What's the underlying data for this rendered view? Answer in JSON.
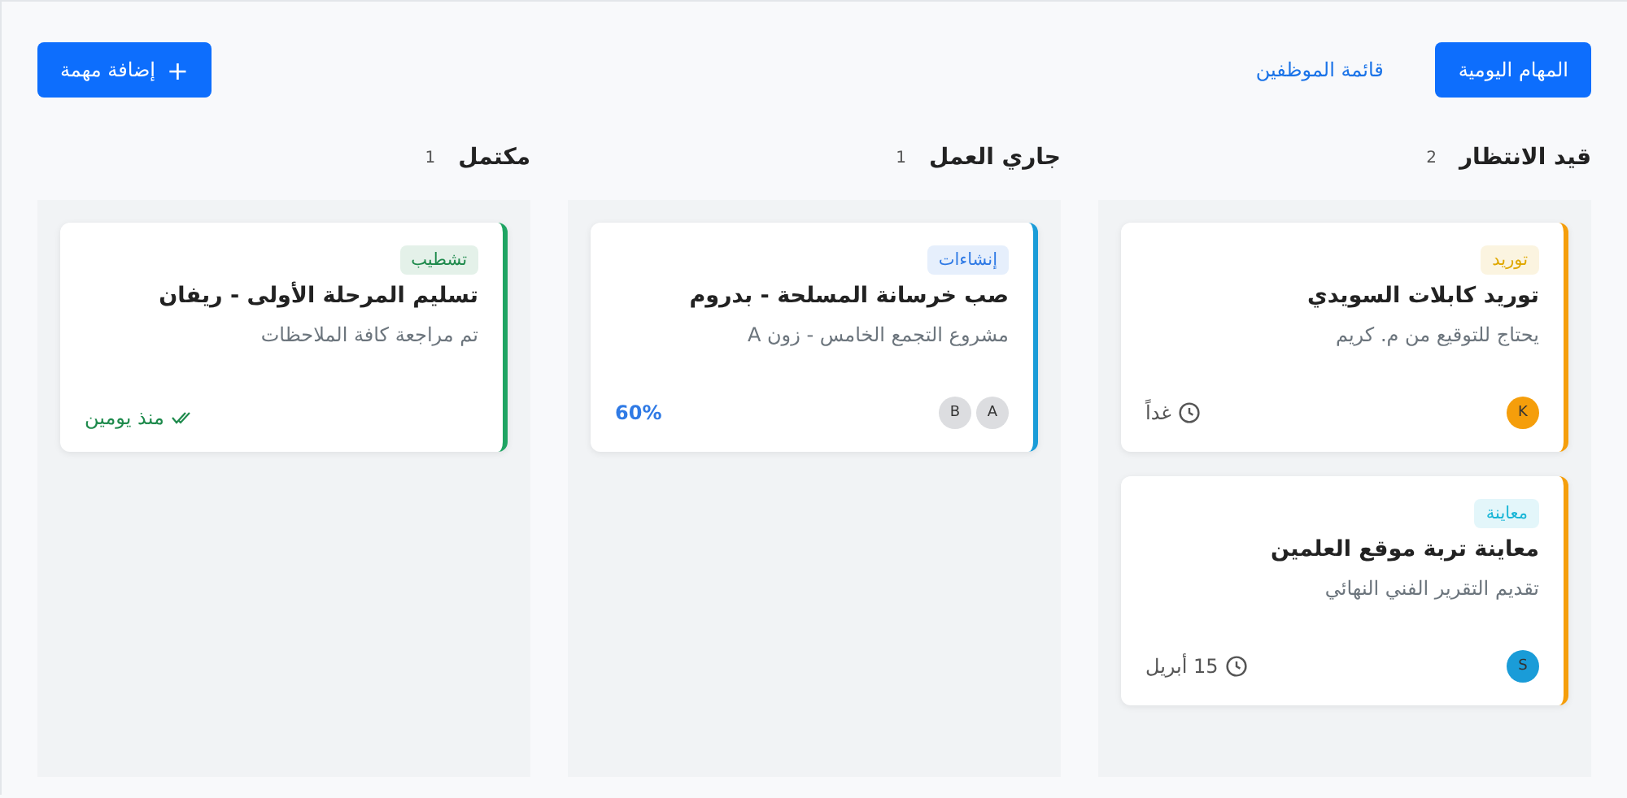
{
  "toolbar": {
    "tabs": [
      {
        "label": "المهام اليومية",
        "selected": true
      },
      {
        "label": "قائمة الموظفين",
        "selected": false
      }
    ],
    "add_button": {
      "label": "إضافة مهمة",
      "icon": "+"
    }
  },
  "columns": [
    {
      "title": "قيد الانتظار",
      "count": "2",
      "cards": [
        {
          "tag": {
            "label": "توريد",
            "color": "#e0a800"
          },
          "title": "توريد كابلات السويدي",
          "description": "يحتاج للتوقيع من م. كريم",
          "color": "#f59e0b",
          "avatars": [
            {
              "initial": "K",
              "color": "#f59e0b"
            }
          ],
          "footer": {
            "kind": "due",
            "text": "غداً"
          }
        },
        {
          "tag": {
            "label": "معاينة",
            "color": "#17b5d6"
          },
          "title": "معاينة تربة موقع العلمين",
          "description": "تقديم التقرير الفني النهائي",
          "color": "#f59e0b",
          "avatars": [
            {
              "initial": "S",
              "color": "#1a9cd8"
            }
          ],
          "footer": {
            "kind": "due",
            "text": "15 أبريل"
          }
        }
      ]
    },
    {
      "title": "جاري العمل",
      "count": "1",
      "cards": [
        {
          "tag": {
            "label": "إنشاءات",
            "color": "#2f7ae5"
          },
          "title": "صب خرسانة المسلحة - بدروم",
          "description": "مشروع التجمع الخامس - زون A",
          "color": "#1a9cd8",
          "avatars": [
            {
              "initial": "A",
              "color": "#dcdde0"
            },
            {
              "initial": "B",
              "color": "#dcdde0"
            }
          ],
          "footer": {
            "kind": "progress",
            "text": "60%"
          }
        }
      ]
    },
    {
      "title": "مكتمل",
      "count": "1",
      "cards": [
        {
          "tag": {
            "label": "تشطيب",
            "color": "#1e8a4c"
          },
          "title": "تسليم المرحلة الأولى - ريفان",
          "description": "تم مراجعة كافة الملاحظات",
          "color": "#1fa463",
          "footer": {
            "kind": "done",
            "text": "منذ يومين"
          }
        }
      ]
    }
  ]
}
